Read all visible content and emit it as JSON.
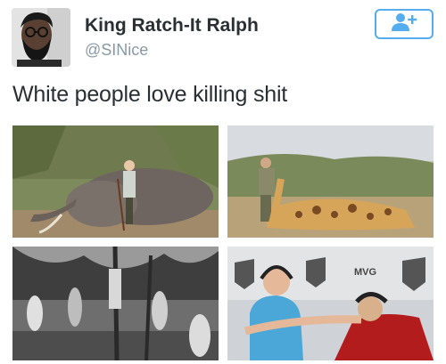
{
  "tweet": {
    "display_name": "King Ratch-It Ralph",
    "handle": "@SINice",
    "text": "White people love killing shit"
  },
  "header": {
    "follow_icon": "add-user-icon"
  },
  "photos": [
    {
      "subject": "hunter-with-elephant"
    },
    {
      "subject": "hunter-with-giraffe"
    },
    {
      "subject": "black-and-white-crowd-photo"
    },
    {
      "subject": "esports-players-mvg"
    }
  ],
  "banner_text": {
    "mvg": "MVG",
    "mvg_shield": "MVG"
  },
  "colors": {
    "accent": "#55acee",
    "name": "#292f33",
    "handle": "#8899a6"
  }
}
